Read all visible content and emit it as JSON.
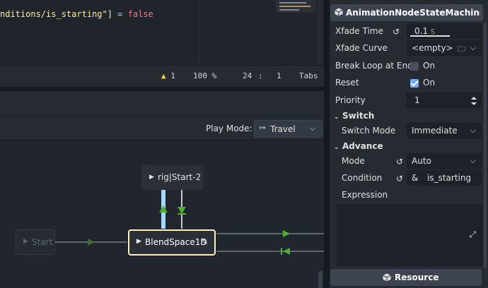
{
  "code": {
    "line_string": "nditions/is_starting\"]",
    "line_op": " = ",
    "line_value": "false"
  },
  "status_bar": {
    "warning_count": "1",
    "zoom": "100 %",
    "line": "24",
    "column": "1",
    "indent": "Tabs"
  },
  "state_machine": {
    "play_mode_label": "Play Mode:",
    "play_mode_value": "Travel",
    "nodes": {
      "start": "Start",
      "rig": "rig|Start-2",
      "blend": "BlendSpace1D"
    }
  },
  "inspector": {
    "title": "AnimationNodeStateMachineTransition",
    "xfade_time_label": "Xfade Time",
    "xfade_time_value": "0.1",
    "xfade_time_unit": "s",
    "xfade_curve_label": "Xfade Curve",
    "xfade_curve_value": "<empty>",
    "break_loop_label": "Break Loop at End",
    "break_loop_value": "On",
    "reset_label": "Reset",
    "reset_value": "On",
    "priority_label": "Priority",
    "priority_value": "1",
    "switch_section": "Switch",
    "switch_mode_label": "Switch Mode",
    "switch_mode_value": "Immediate",
    "advance_section": "Advance",
    "mode_label": "Mode",
    "mode_value": "Auto",
    "condition_label": "Condition",
    "condition_value": "is_starting",
    "condition_prefix": "&",
    "expression_label": "Expression",
    "resource_button": "Resource"
  },
  "colors": {
    "accent": "#6ea8ff",
    "transition_green": "#4caf2f",
    "active_blue": "#a8d8ff",
    "selected_border": "#fff3c2",
    "warning": "#ffcc33"
  }
}
